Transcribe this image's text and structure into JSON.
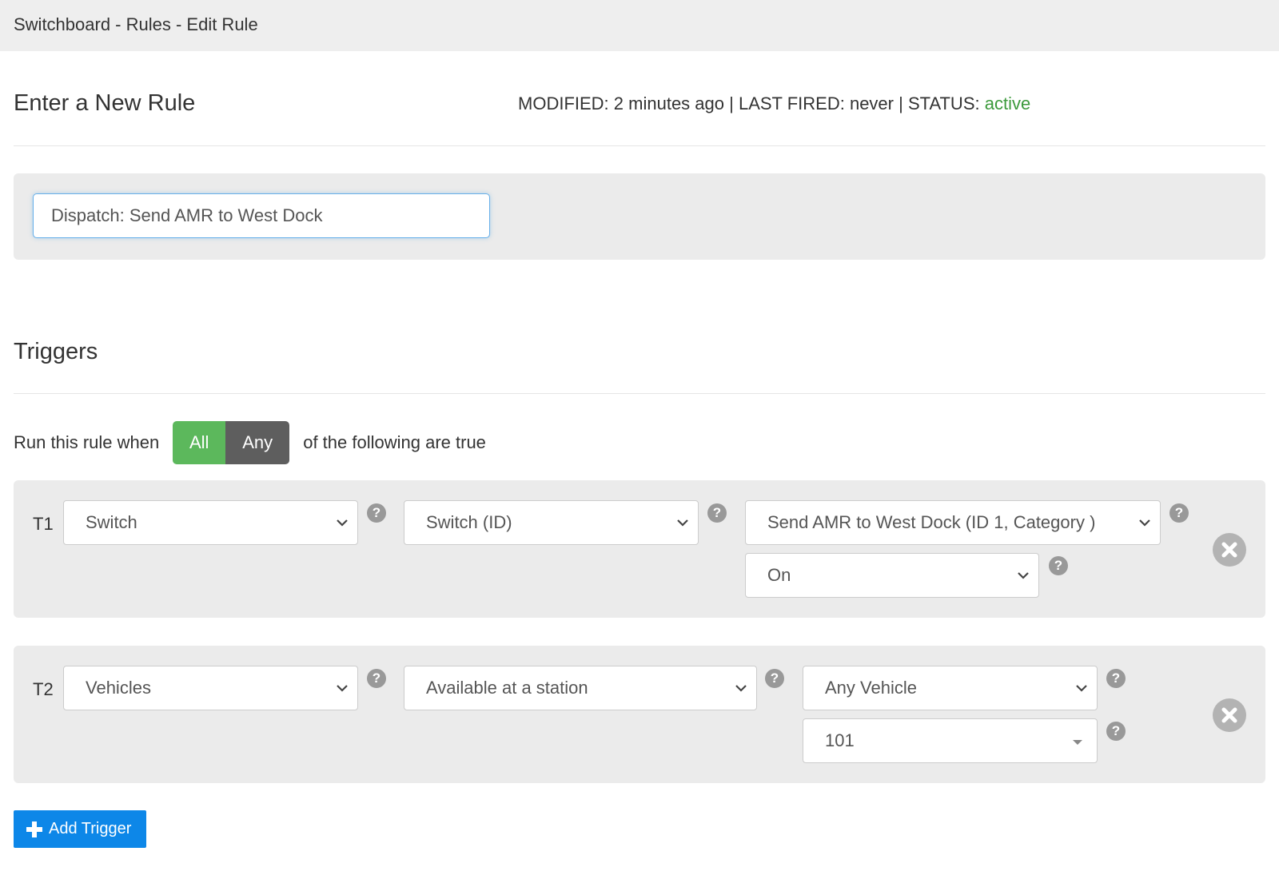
{
  "window": {
    "title": "Switchboard - Rules - Edit Rule"
  },
  "rule": {
    "heading": "Enter a New Rule",
    "modified_label": "MODIFIED:",
    "modified_value": "2 minutes ago",
    "separator": "|",
    "last_fired_label": "LAST FIRED:",
    "last_fired_value": "never",
    "status_label": "STATUS:",
    "status_value": "active",
    "status_color": "#3c9a3c",
    "name_value": "Dispatch: Send AMR to West Dock"
  },
  "triggers": {
    "heading": "Triggers",
    "run_prefix": "Run this rule when",
    "run_suffix": "of the following are true",
    "toggle": {
      "all_label": "All",
      "any_label": "Any",
      "selected": "All"
    },
    "items": [
      {
        "label": "T1",
        "type": "Switch",
        "attribute": "Switch (ID)",
        "target": "Send AMR to West Dock (ID 1, Category )",
        "value": "On"
      },
      {
        "label": "T2",
        "type": "Vehicles",
        "attribute": "Available at a station",
        "target": "Any Vehicle",
        "value": "101"
      }
    ],
    "help_glyph": "?",
    "add_button_label": "Add Trigger"
  },
  "colors": {
    "accent_blue": "#0d87e8",
    "toggle_active": "#5cb85c",
    "toggle_inactive": "#5e5e5e",
    "panel_bg": "#ebebeb"
  }
}
